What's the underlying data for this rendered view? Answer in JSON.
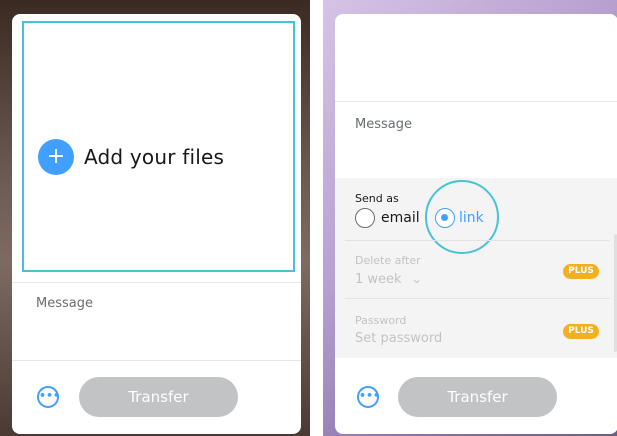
{
  "left_panel": {
    "add_files_label": "Add your files",
    "add_icon_glyph": "+",
    "message_placeholder": "Message",
    "more_icon_glyph": "•••",
    "transfer_label": "Transfer"
  },
  "right_panel": {
    "message_placeholder": "Message",
    "send_as_label": "Send as",
    "options": [
      {
        "label": "email",
        "selected": false
      },
      {
        "label": "link",
        "selected": true
      }
    ],
    "delete_after": {
      "label": "Delete after",
      "value": "1 week",
      "chevron_glyph": "⌄",
      "badge": "PLUS"
    },
    "password": {
      "label": "Password",
      "placeholder": "Set password",
      "badge": "PLUS"
    },
    "more_icon_glyph": "•••",
    "transfer_label": "Transfer"
  },
  "colors": {
    "accent_blue": "#409fff",
    "highlight_teal": "#47c3d4",
    "plus_badge": "#f2b01e",
    "disabled_button": "#c2c3c5"
  }
}
